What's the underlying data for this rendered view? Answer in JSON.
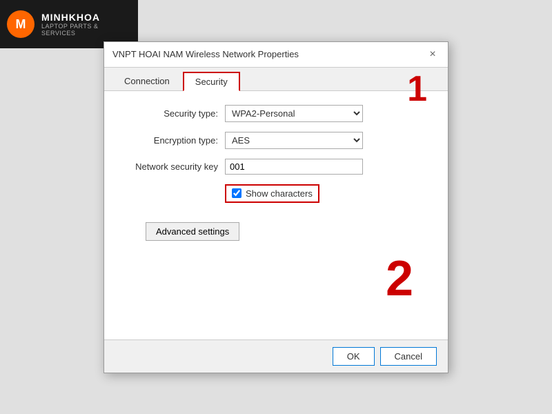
{
  "watermark": {
    "logo": "M",
    "brand": "MINHKHOA",
    "subtitle": "LAPTOP PARTS & SERVICES"
  },
  "dialog": {
    "title": "VNPT HOAI NAM Wireless Network Properties",
    "close_label": "×",
    "tabs": [
      {
        "id": "connection",
        "label": "Connection"
      },
      {
        "id": "security",
        "label": "Security"
      }
    ],
    "active_tab": "security",
    "form": {
      "security_type_label": "Security type:",
      "security_type_value": "WPA2-Personal",
      "encryption_type_label": "Encryption type:",
      "encryption_type_value": "AES",
      "network_key_label": "Network security key",
      "network_key_value": "001",
      "show_characters_label": "Show characters",
      "show_characters_checked": true
    },
    "advanced_button": "Advanced settings",
    "footer": {
      "ok": "OK",
      "cancel": "Cancel"
    }
  },
  "annotations": {
    "one": "1",
    "two": "2"
  }
}
